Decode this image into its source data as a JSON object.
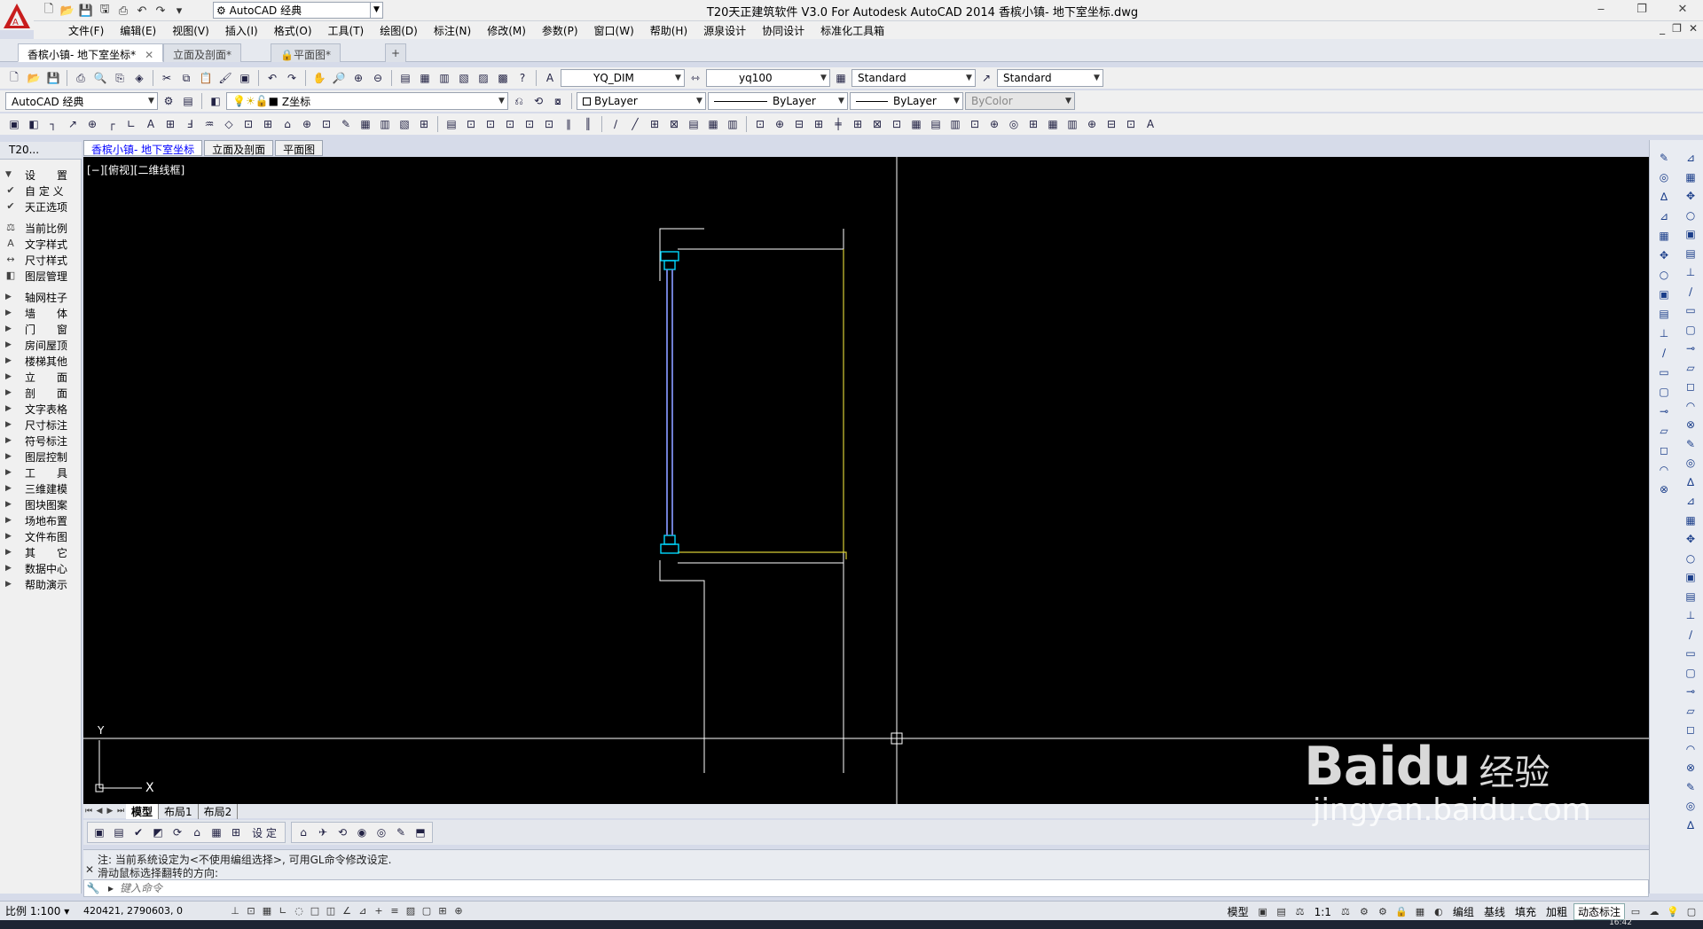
{
  "window": {
    "title": "T20天正建筑软件 V3.0 For Autodesk AutoCAD 2014    香槟小镇- 地下室坐标.dwg",
    "workspace": "AutoCAD 经典",
    "minimize": "‒",
    "restore": "❐",
    "close": "✕"
  },
  "menu": {
    "items": [
      "文件(F)",
      "编辑(E)",
      "视图(V)",
      "插入(I)",
      "格式(O)",
      "工具(T)",
      "绘图(D)",
      "标注(N)",
      "修改(M)",
      "参数(P)",
      "窗口(W)",
      "帮助(H)",
      "源泉设计",
      "协同设计",
      "标准化工具箱"
    ],
    "right_min": "_",
    "right_restore": "❐",
    "right_close": "✕"
  },
  "doc_tabs": [
    {
      "label": "香槟小镇- 地下室坐标*"
    },
    {
      "label": "立面及剖面*"
    },
    {
      "label": "平面图*"
    }
  ],
  "toolbar": {
    "text_style": "YQ_DIM",
    "dim_style": "yq100",
    "table_style": "Standard",
    "multileader_style": "Standard",
    "workspace2": "AutoCAD 经典",
    "layer": "Z坐标",
    "color": "ByLayer",
    "linetype": "ByLayer",
    "lineweight": "ByLayer",
    "plotstyle": "ByColor"
  },
  "sidebar": {
    "header": "T20...",
    "items": [
      {
        "label": "设　　置",
        "type": "group",
        "icon": "triangle-down"
      },
      {
        "label": "自 定 义",
        "type": "item",
        "icon": "check"
      },
      {
        "label": "天正选项",
        "type": "item",
        "icon": "check"
      },
      {
        "label": "当前比例",
        "type": "item",
        "icon": "scale"
      },
      {
        "label": "文字样式",
        "type": "item",
        "icon": "text"
      },
      {
        "label": "尺寸样式",
        "type": "item",
        "icon": "dim"
      },
      {
        "label": "图层管理",
        "type": "item",
        "icon": "layers"
      },
      {
        "label": "轴网柱子",
        "type": "group"
      },
      {
        "label": "墙　　体",
        "type": "group"
      },
      {
        "label": "门　　窗",
        "type": "group"
      },
      {
        "label": "房间屋顶",
        "type": "group"
      },
      {
        "label": "楼梯其他",
        "type": "group"
      },
      {
        "label": "立　　面",
        "type": "group"
      },
      {
        "label": "剖　　面",
        "type": "group"
      },
      {
        "label": "文字表格",
        "type": "group"
      },
      {
        "label": "尺寸标注",
        "type": "group"
      },
      {
        "label": "符号标注",
        "type": "group"
      },
      {
        "label": "图层控制",
        "type": "group"
      },
      {
        "label": "工　　具",
        "type": "group"
      },
      {
        "label": "三维建模",
        "type": "group"
      },
      {
        "label": "图块图案",
        "type": "group"
      },
      {
        "label": "场地布置",
        "type": "group"
      },
      {
        "label": "文件布图",
        "type": "group"
      },
      {
        "label": "其　　它",
        "type": "group"
      },
      {
        "label": "数据中心",
        "type": "group"
      },
      {
        "label": "帮助演示",
        "type": "group"
      }
    ]
  },
  "view_tabs": [
    "香槟小镇- 地下室坐标",
    "立面及剖面",
    "平面图"
  ],
  "viewport_label": "[−][俯视][二维线框]",
  "ucs": {
    "x": "X",
    "y": "Y"
  },
  "layout_tabs": [
    "模型",
    "布局1",
    "布局2"
  ],
  "bottom_toolbar_text": "设 定",
  "command": {
    "history": [
      "注: 当前系统设定为<不使用编组选择>, 可用GL命令修改设定.",
      "滑动鼠标选择翻转的方向:"
    ],
    "placeholder": "键入命令"
  },
  "status": {
    "scale": "比例 1:100",
    "coords": "420421, 2790603, 0",
    "model": "模型",
    "annot_scale": "1:1",
    "right_items": [
      "编组",
      "基线",
      "填充",
      "加粗",
      "动态标注"
    ],
    "clock": "16:42"
  },
  "watermark": {
    "brand": "Baidu",
    "cn": "经验",
    "url": "jingyan.baidu.com"
  }
}
